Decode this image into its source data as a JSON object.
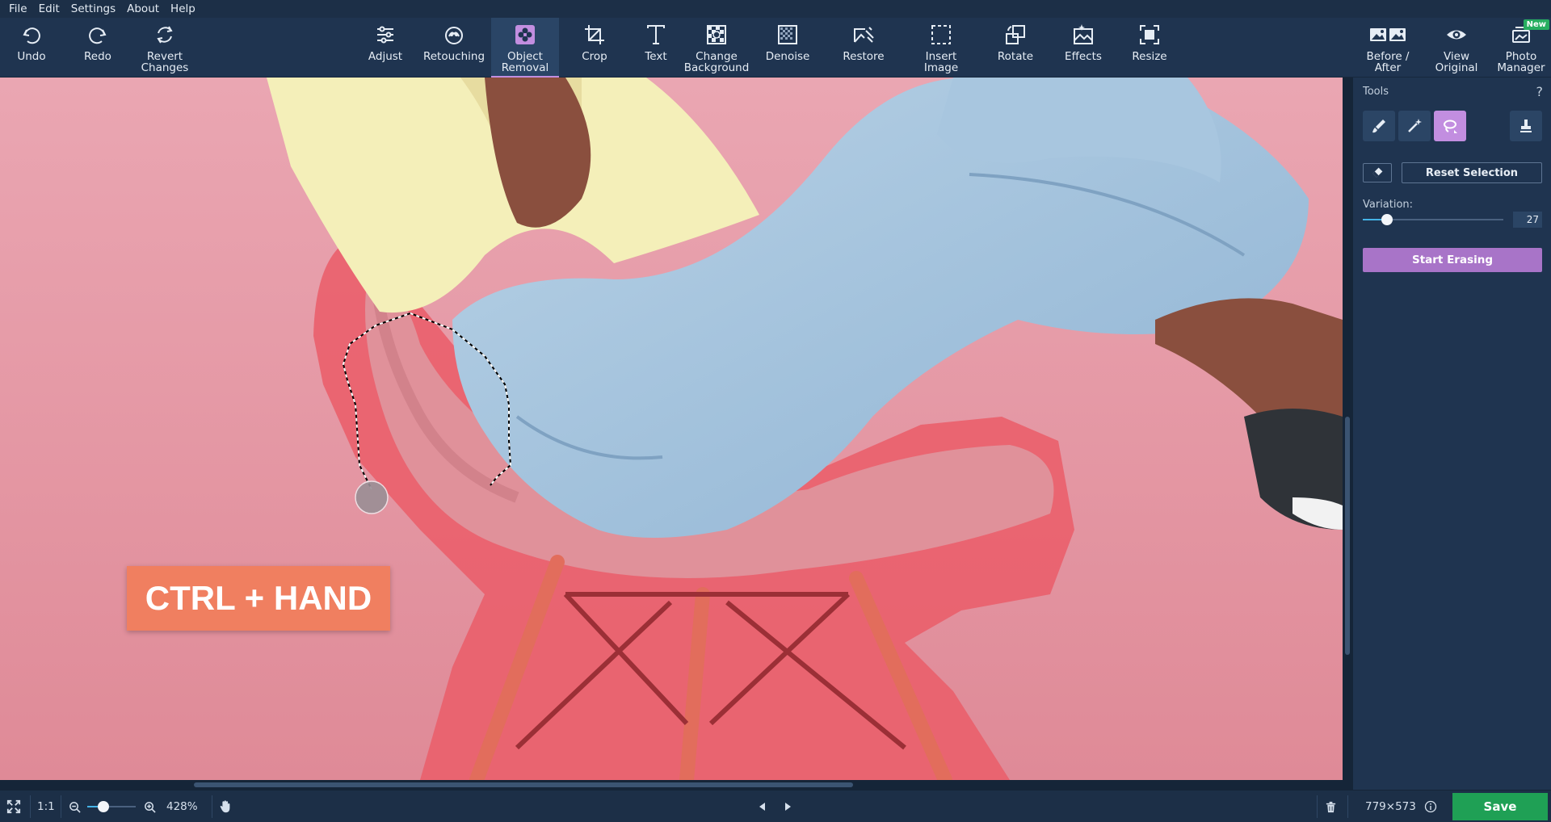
{
  "menu": [
    "File",
    "Edit",
    "Settings",
    "About",
    "Help"
  ],
  "toolbar": {
    "undo": "Undo",
    "redo": "Redo",
    "revert": "Revert\nChanges",
    "adjust": "Adjust",
    "retouching": "Retouching",
    "object_removal": "Object\nRemoval",
    "crop": "Crop",
    "text": "Text",
    "change_background": "Change\nBackground",
    "denoise": "Denoise",
    "restore": "Restore",
    "insert_image": "Insert\nImage",
    "rotate": "Rotate",
    "effects": "Effects",
    "resize": "Resize",
    "before_after": "Before /\nAfter",
    "view_original": "View\nOriginal",
    "photo_manager": "Photo\nManager",
    "new_badge": "New",
    "active_tool": "Object Removal"
  },
  "canvas": {
    "hint": "CTRL + HAND"
  },
  "panel": {
    "tools_title": "Tools",
    "help": "?",
    "reset_selection": "Reset Selection",
    "variation_label": "Variation:",
    "variation_value": "27",
    "variation_fraction": 0.17,
    "start_erasing": "Start Erasing",
    "active_tool": "lasso",
    "accent": "#c28ee0"
  },
  "status": {
    "ratio": "1:1",
    "zoom": "428%",
    "zoom_fraction": 0.33,
    "dimensions": "779×573",
    "save": "Save"
  }
}
